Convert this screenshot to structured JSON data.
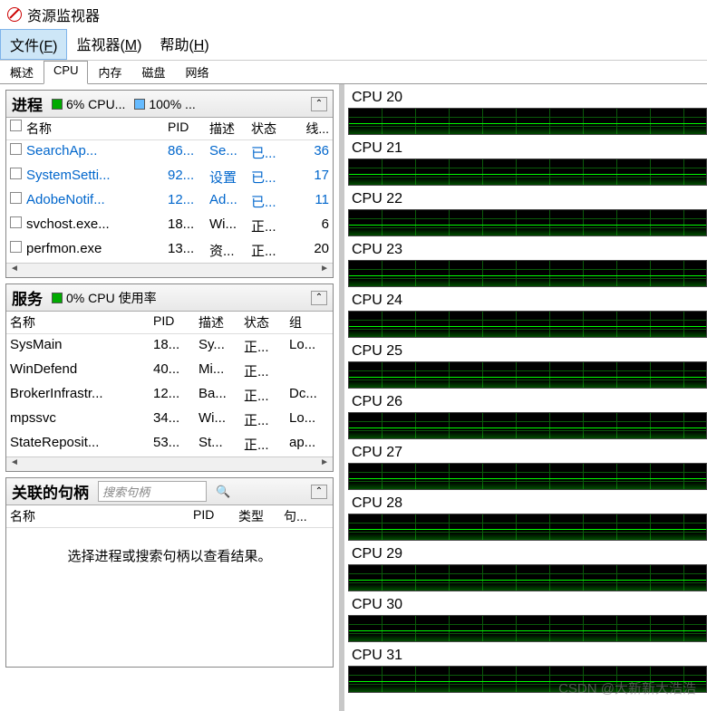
{
  "window": {
    "title": "资源监视器"
  },
  "menu": {
    "file": "文件(F)",
    "monitor": "监视器(M)",
    "help": "帮助(H)"
  },
  "tabs": {
    "overview": "概述",
    "cpu": "CPU",
    "memory": "内存",
    "disk": "磁盘",
    "network": "网络"
  },
  "processes": {
    "title": "进程",
    "meter1": "6% CPU...",
    "meter2": "100% ...",
    "cols": {
      "name": "名称",
      "pid": "PID",
      "desc": "描述",
      "stat": "状态",
      "thr": "线..."
    },
    "rows": [
      {
        "name": "SearchAp...",
        "pid": "86...",
        "desc": "Se...",
        "stat": "已...",
        "thr": "36",
        "link": true
      },
      {
        "name": "SystemSetti...",
        "pid": "92...",
        "desc": "设置",
        "stat": "已...",
        "thr": "17",
        "link": true
      },
      {
        "name": "AdobeNotif...",
        "pid": "12...",
        "desc": "Ad...",
        "stat": "已...",
        "thr": "11",
        "link": true
      },
      {
        "name": "svchost.exe...",
        "pid": "18...",
        "desc": "Wi...",
        "stat": "正...",
        "thr": "6",
        "link": false
      },
      {
        "name": "perfmon.exe",
        "pid": "13...",
        "desc": "资...",
        "stat": "正...",
        "thr": "20",
        "link": false
      }
    ]
  },
  "services": {
    "title": "服务",
    "meter1": "0% CPU 使用率",
    "cols": {
      "name": "名称",
      "pid": "PID",
      "desc": "描述",
      "stat": "状态",
      "grp": "组"
    },
    "rows": [
      {
        "name": "SysMain",
        "pid": "18...",
        "desc": "Sy...",
        "stat": "正...",
        "grp": "Lo..."
      },
      {
        "name": "WinDefend",
        "pid": "40...",
        "desc": "Mi...",
        "stat": "正...",
        "grp": ""
      },
      {
        "name": "BrokerInfrastr...",
        "pid": "12...",
        "desc": "Ba...",
        "stat": "正...",
        "grp": "Dc..."
      },
      {
        "name": "mpssvc",
        "pid": "34...",
        "desc": "Wi...",
        "stat": "正...",
        "grp": "Lo..."
      },
      {
        "name": "StateReposit...",
        "pid": "53...",
        "desc": "St...",
        "stat": "正...",
        "grp": "ap..."
      }
    ]
  },
  "handles": {
    "title": "关联的句柄",
    "search_placeholder": "搜索句柄",
    "cols": {
      "name": "名称",
      "pid": "PID",
      "type": "类型",
      "hnd": "句..."
    },
    "empty": "选择进程或搜索句柄以查看结果。"
  },
  "cpus": [
    "CPU 20",
    "CPU 21",
    "CPU 22",
    "CPU 23",
    "CPU 24",
    "CPU 25",
    "CPU 26",
    "CPU 27",
    "CPU 28",
    "CPU 29",
    "CPU 30",
    "CPU 31"
  ],
  "watermark": "CSDN @大新新大浩浩"
}
